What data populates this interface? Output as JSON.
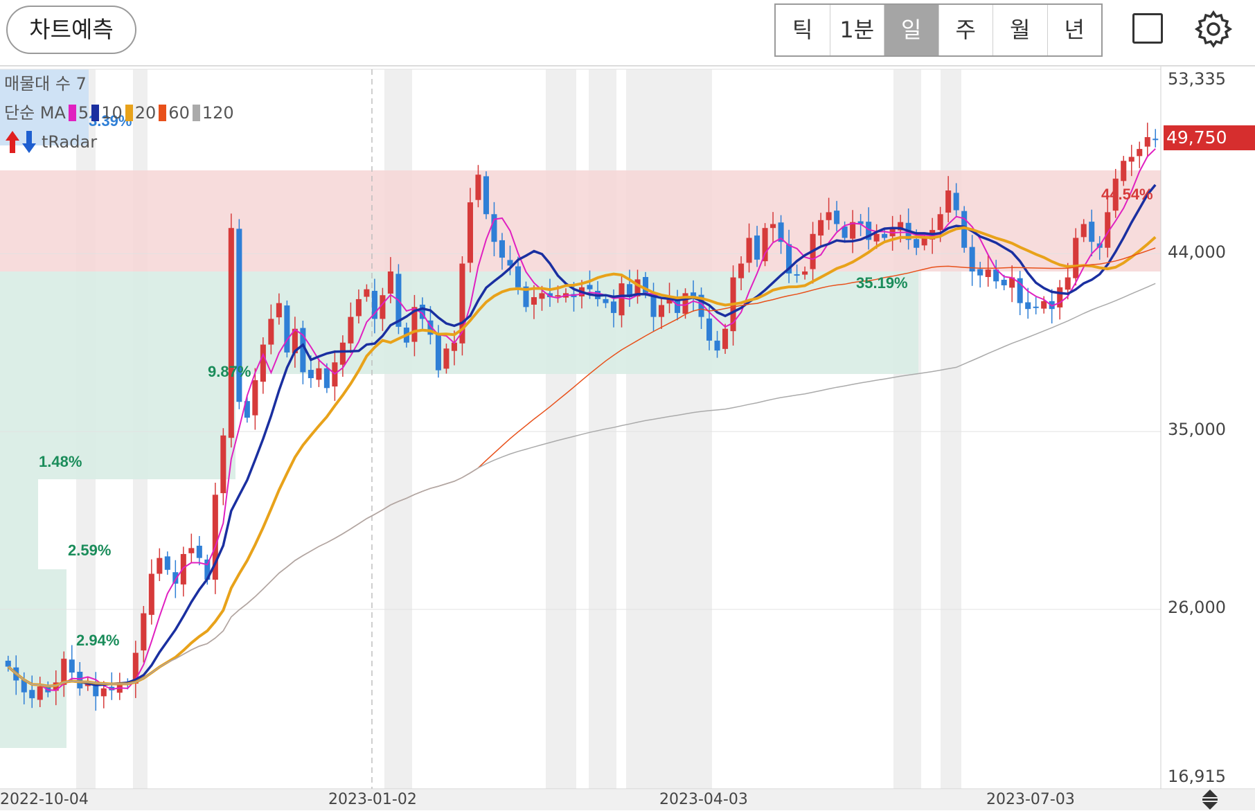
{
  "header": {
    "predict_button": "차트예측",
    "period_tabs": [
      {
        "label": "틱",
        "active": false
      },
      {
        "label": "1분",
        "active": false
      },
      {
        "label": "일",
        "active": true
      },
      {
        "label": "주",
        "active": false
      },
      {
        "label": "월",
        "active": false
      },
      {
        "label": "년",
        "active": false
      }
    ],
    "icons": [
      "square-icon",
      "gear-icon"
    ]
  },
  "legend": {
    "volume_profile": "매물대 수 7",
    "ma_label": "단순 MA",
    "ma_periods": [
      {
        "period": "5",
        "color": "#e020c0"
      },
      {
        "period": "10",
        "color": "#1a2fa0"
      },
      {
        "period": "20",
        "color": "#e8a21a"
      },
      {
        "period": "60",
        "color": "#e8501a"
      },
      {
        "period": "120",
        "color": "#aaaaaa"
      }
    ],
    "indicator": "tRadar"
  },
  "price_axis": {
    "labels": [
      "53,335",
      "44,000",
      "35,000",
      "26,000",
      "16,915"
    ],
    "current_price": "49,750",
    "current_price_color": "#d62e2e"
  },
  "date_axis": [
    "2022-10-04",
    "2023-01-02",
    "2023-04-03",
    "2023-07-03"
  ],
  "colors": {
    "up": "#d63a3a",
    "down": "#2f7fd6",
    "resistance_zone": "#f6d6d6",
    "support_zone": "#d8ece4"
  },
  "chart_data": {
    "type": "candlestick",
    "title": "",
    "ylim": [
      16915,
      53335
    ],
    "y_ticks": [
      53335,
      44000,
      35000,
      26000,
      16915
    ],
    "x_ticks": [
      "2022-10-04",
      "2023-01-02",
      "2023-04-03",
      "2023-07-03"
    ],
    "close_series": [
      23100,
      22400,
      21800,
      21500,
      22100,
      21800,
      22300,
      23500,
      22800,
      22000,
      22300,
      21600,
      22000,
      21900,
      22300,
      22200,
      23800,
      25800,
      27800,
      28600,
      28000,
      27300,
      28800,
      29100,
      28600,
      27500,
      31800,
      34800,
      45300,
      36500,
      35700,
      37600,
      39400,
      40700,
      41500,
      39000,
      40200,
      38000,
      37700,
      38200,
      37200,
      38500,
      39500,
      40800,
      41700,
      42200,
      40700,
      41900,
      43100,
      40300,
      39500,
      41300,
      40700,
      39900,
      38100,
      39200,
      39500,
      43500,
      46600,
      48000,
      46000,
      44600,
      43800,
      43400,
      42300,
      41300,
      41800,
      42000,
      41800,
      41900,
      42000,
      41800,
      42300,
      42200,
      41700,
      41500,
      41000,
      42500,
      41800,
      42700,
      42000,
      40800,
      41400,
      41800,
      41000,
      42000,
      41800,
      40800,
      39600,
      39100,
      40200,
      42800,
      43500,
      44800,
      43700,
      45300,
      45500,
      44600,
      43000,
      42900,
      43100,
      45000,
      45700,
      46100,
      45500,
      44800,
      45600,
      45500,
      44700,
      45000,
      44800,
      45300,
      45600,
      44700,
      44300,
      44800,
      45200,
      46000,
      47200,
      46200,
      44300,
      43100,
      42900,
      43200,
      42600,
      42400,
      42800,
      41500,
      41200,
      41300,
      41600,
      41200,
      42300,
      42800,
      44800,
      45500,
      44600,
      44300,
      46100,
      47800,
      48700,
      48900,
      49300,
      49900,
      49750
    ],
    "annotations": [
      "3.39%",
      "9.87%",
      "1.48%",
      "2.59%",
      "2.94%",
      "35.19%",
      "44.54%"
    ],
    "zones": [
      {
        "name": "resistance",
        "from": 42800,
        "to": 47900
      },
      {
        "name": "support",
        "from": 37900,
        "to": 42800
      }
    ]
  }
}
